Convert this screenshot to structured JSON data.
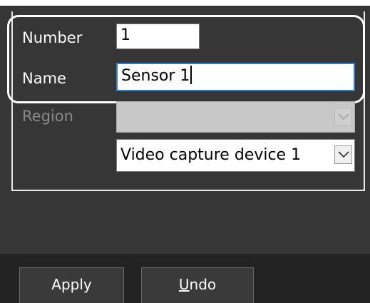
{
  "form": {
    "number_label": "Number",
    "number_value": "1",
    "name_label": "Name",
    "name_value": "Sensor 1",
    "region_label": "Region",
    "region_value": "",
    "device_value": "Video capture device 1"
  },
  "footer": {
    "apply_label": "Apply",
    "undo_mnemonic": "U",
    "undo_rest": "ndo"
  },
  "colors": {
    "panel_bg": "#363636",
    "footer_bg": "#232323",
    "focus_border": "#2b7fd6",
    "highlight_ring": "#ffffff"
  }
}
